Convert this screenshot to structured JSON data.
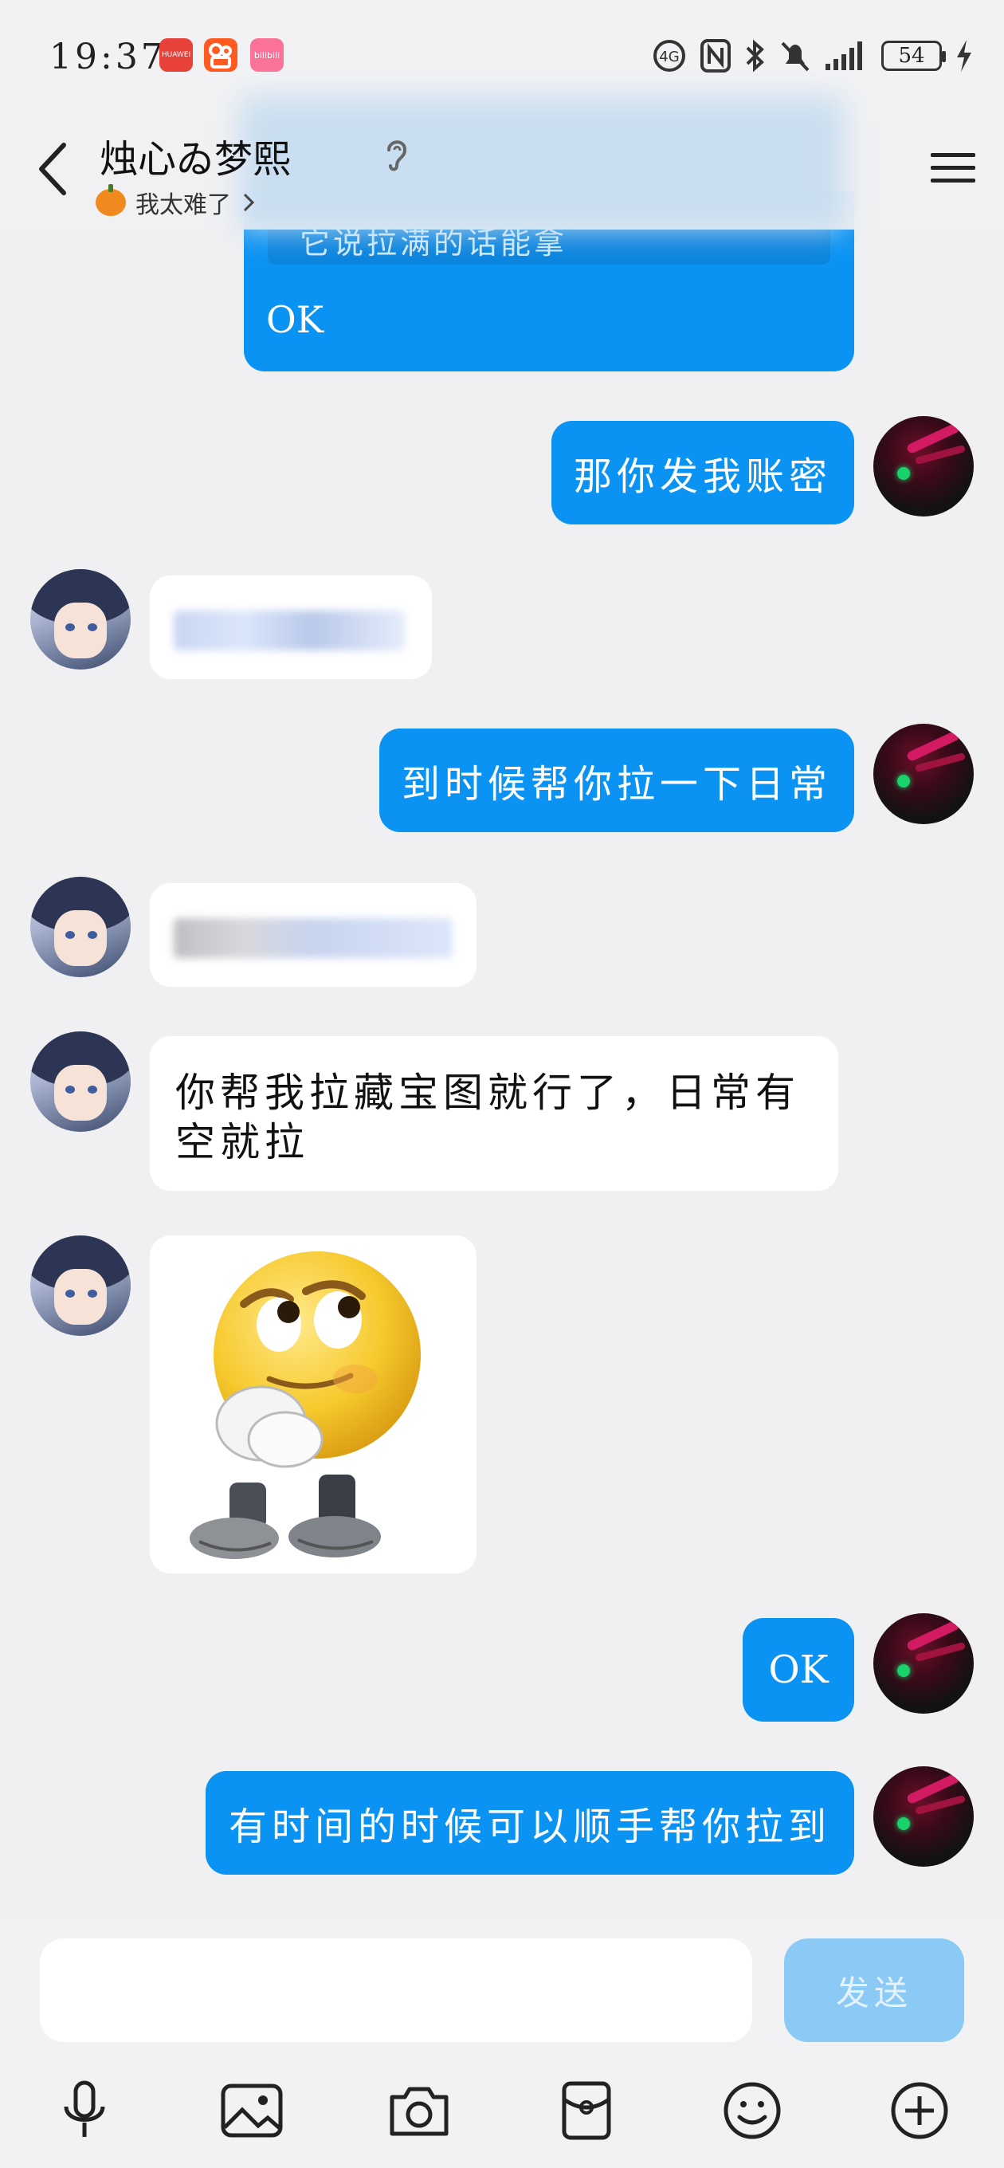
{
  "status_bar": {
    "time": "19:37",
    "battery": "54",
    "apps": [
      "HUAWEI",
      "",
      "bilibili"
    ]
  },
  "header": {
    "title": "烛心ゐ梦熙",
    "status_text": "我太难了",
    "status_icon": "pumpkin-icon"
  },
  "messages": [
    {
      "from": "me",
      "type": "quote",
      "text": "OK",
      "quoted_fragment": "它说拉满的话能拿"
    },
    {
      "from": "me",
      "type": "text",
      "text": "那你发我账密"
    },
    {
      "from": "friend",
      "type": "blurred"
    },
    {
      "from": "me",
      "type": "text",
      "text": "到时候帮你拉一下日常"
    },
    {
      "from": "friend",
      "type": "blurred"
    },
    {
      "from": "friend",
      "type": "text",
      "line1": "你帮我拉藏宝图就行了，日常有",
      "line2": "空就拉"
    },
    {
      "from": "friend",
      "type": "sticker",
      "sticker": "thinking-smiley-sticker"
    },
    {
      "from": "me",
      "type": "text",
      "text": "OK"
    },
    {
      "from": "me",
      "type": "text",
      "text": "有时间的时候可以顺手帮你拉到"
    }
  ],
  "input": {
    "value": "",
    "send_label": "发送"
  },
  "toolbar": [
    "microphone-icon",
    "image-icon",
    "camera-icon",
    "red-packet-icon",
    "emoji-icon",
    "plus-icon"
  ],
  "colors": {
    "outgoing_bubble": "#0b93f3",
    "incoming_bubble": "#ffffff",
    "background": "#f0f0f2",
    "send_button": "#8ccaf6"
  }
}
